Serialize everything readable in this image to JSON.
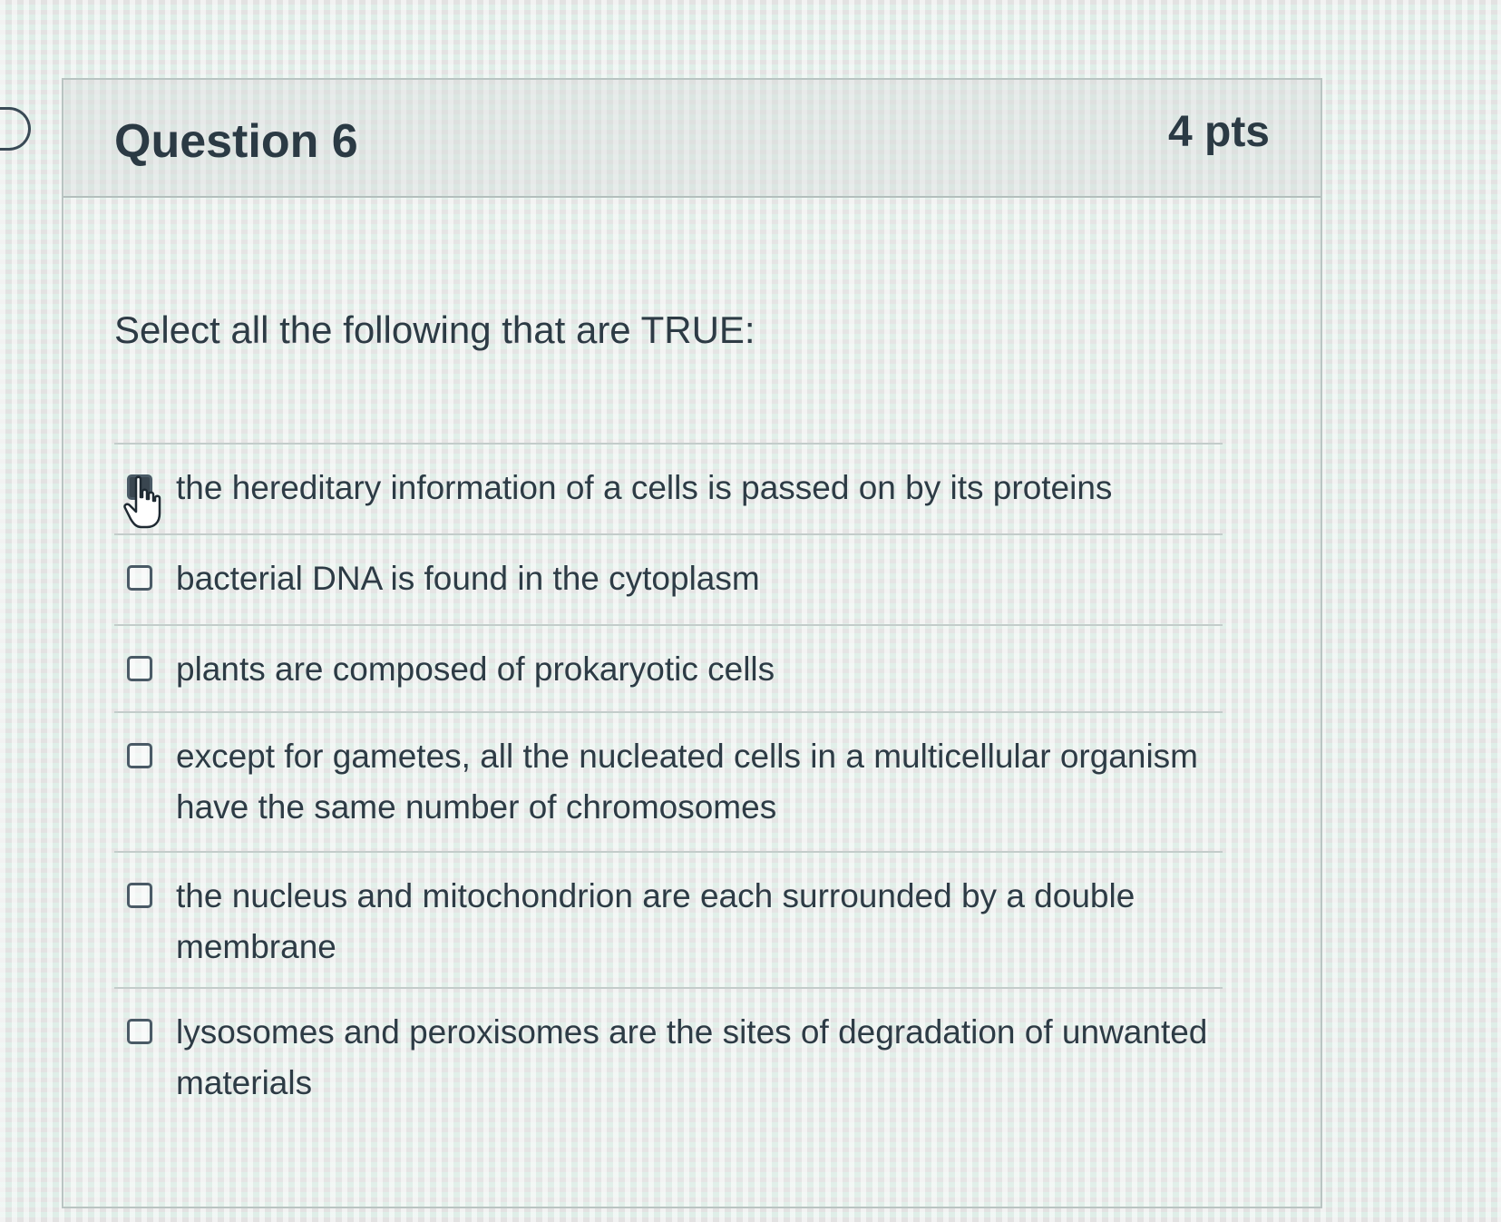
{
  "question": {
    "title": "Question 6",
    "points": "4 pts",
    "prompt": "Select all the following that are TRUE:"
  },
  "answers": [
    {
      "label": "the hereditary information of a cells is passed on by its proteins",
      "checked": false
    },
    {
      "label": "bacterial DNA is found in the cytoplasm",
      "checked": false
    },
    {
      "label": "plants are composed of prokaryotic cells",
      "checked": false
    },
    {
      "label": "except for gametes, all the nucleated cells in a multicellular organism have the same number of chromosomes",
      "checked": false
    },
    {
      "label": "the nucleus and mitochondrion are each surrounded by a double membrane",
      "checked": false
    },
    {
      "label": "lysosomes and peroxisomes are the sites of degradation of unwanted materials",
      "checked": false
    }
  ],
  "icons": {
    "side_marker": "question-flag-icon",
    "cursor": "hand-pointer-icon"
  }
}
